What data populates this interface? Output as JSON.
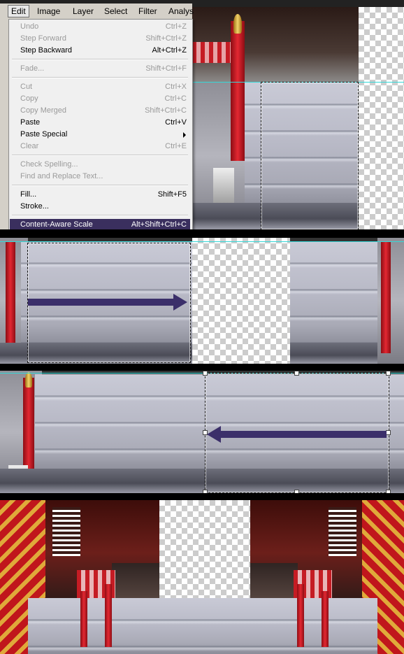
{
  "menubar": {
    "items": [
      "Edit",
      "Image",
      "Layer",
      "Select",
      "Filter",
      "Analys"
    ]
  },
  "edit_menu": {
    "items": [
      {
        "label": "Undo",
        "shortcut": "Ctrl+Z",
        "enabled": false
      },
      {
        "label": "Step Forward",
        "shortcut": "Shift+Ctrl+Z",
        "enabled": false
      },
      {
        "label": "Step Backward",
        "shortcut": "Alt+Ctrl+Z",
        "enabled": true
      },
      {
        "label": "Fade...",
        "shortcut": "Shift+Ctrl+F",
        "enabled": false
      },
      {
        "label": "Cut",
        "shortcut": "Ctrl+X",
        "enabled": false
      },
      {
        "label": "Copy",
        "shortcut": "Ctrl+C",
        "enabled": false
      },
      {
        "label": "Copy Merged",
        "shortcut": "Shift+Ctrl+C",
        "enabled": false
      },
      {
        "label": "Paste",
        "shortcut": "Ctrl+V",
        "enabled": true
      },
      {
        "label": "Paste Special",
        "shortcut": "",
        "enabled": true,
        "submenu": true
      },
      {
        "label": "Clear",
        "shortcut": "Ctrl+E",
        "enabled": false
      },
      {
        "label": "Check Spelling...",
        "shortcut": "",
        "enabled": false
      },
      {
        "label": "Find and Replace Text...",
        "shortcut": "",
        "enabled": false
      },
      {
        "label": "Fill...",
        "shortcut": "Shift+F5",
        "enabled": true
      },
      {
        "label": "Stroke...",
        "shortcut": "",
        "enabled": true
      },
      {
        "label": "Content-Aware Scale",
        "shortcut": "Alt+Shift+Ctrl+C",
        "enabled": true,
        "selected": true
      }
    ]
  },
  "colors": {
    "arrow": "#3b2f6a",
    "selection": "#3a2f5e",
    "guide": "#34d8d8"
  },
  "icons": [
    "submenu-arrow-icon",
    "arrow-right-icon",
    "arrow-left-icon"
  ]
}
